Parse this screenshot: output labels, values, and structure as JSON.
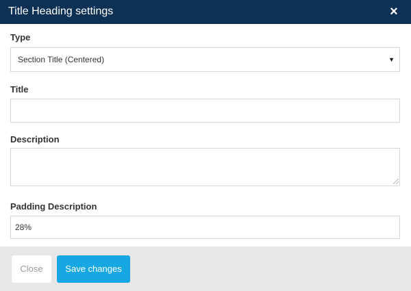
{
  "dialog": {
    "title": "Title Heading settings",
    "close_icon": "×"
  },
  "fields": {
    "type": {
      "label": "Type",
      "selected": "Section Title (Centered)",
      "caret": "▼"
    },
    "title": {
      "label": "Title",
      "value": ""
    },
    "description": {
      "label": "Description",
      "value": ""
    },
    "padding_description": {
      "label": "Padding Description",
      "value": "28%"
    }
  },
  "footer": {
    "close_label": "Close",
    "save_label": "Save changes"
  },
  "colors": {
    "header_bg": "#0d3155",
    "primary_button": "#17a8e3",
    "footer_bg": "#e7e7e7"
  }
}
